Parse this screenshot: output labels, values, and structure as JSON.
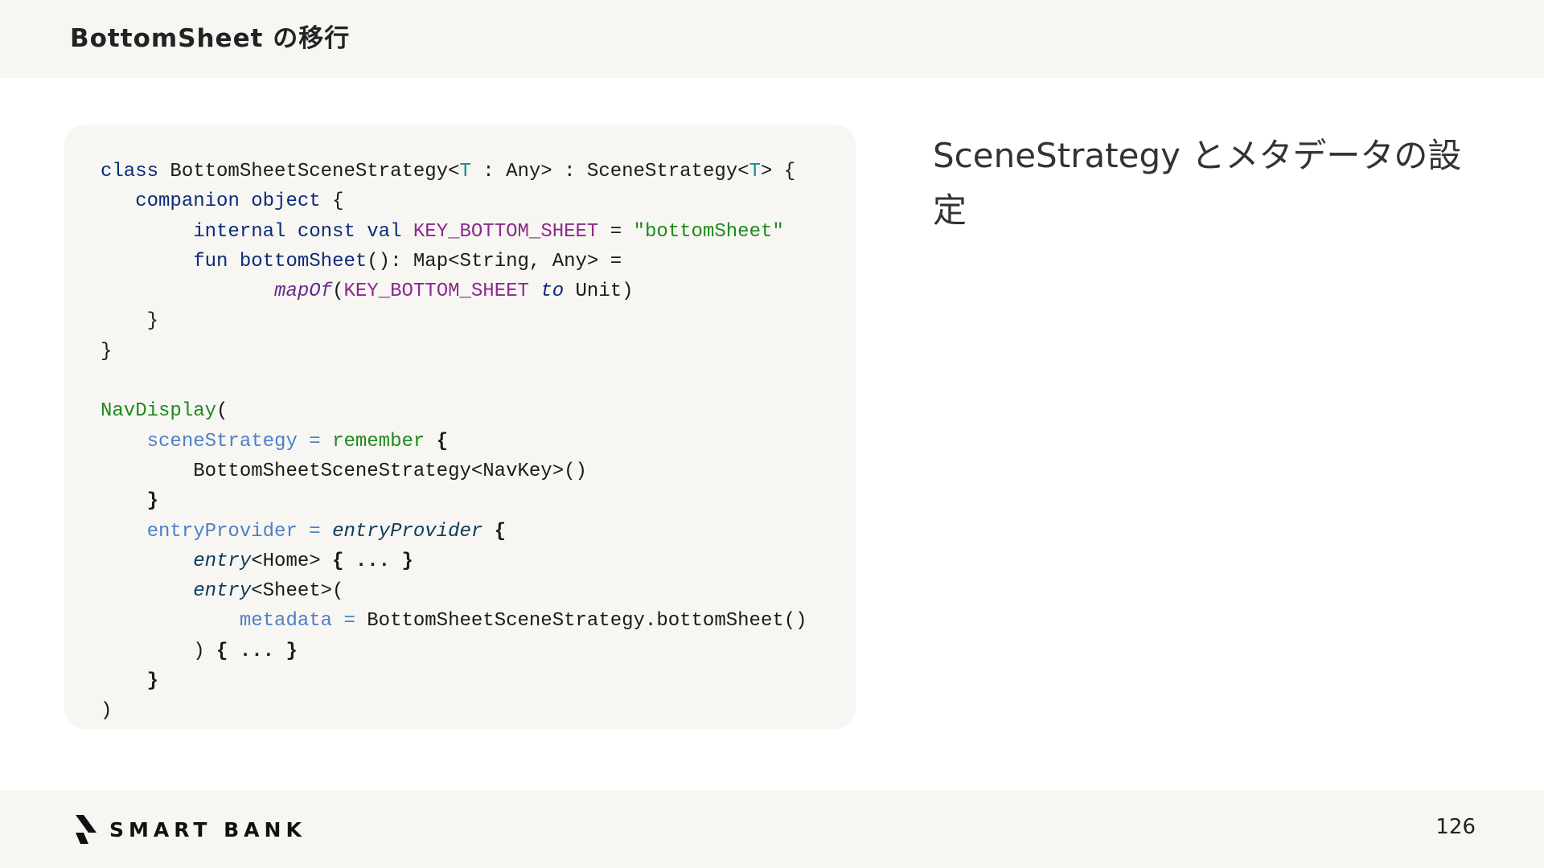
{
  "header": {
    "title": "BottomSheet の移行"
  },
  "code": {
    "lines": [
      "class BottomSheetSceneStrategy<T : Any> : SceneStrategy<T> {",
      "   companion object {",
      "        internal const val KEY_BOTTOM_SHEET = \"bottomSheet\"",
      "        fun bottomSheet(): Map<String, Any> =",
      "               mapOf(KEY_BOTTOM_SHEET to Unit)",
      "    }",
      "}",
      "",
      "NavDisplay(",
      "    sceneStrategy = remember {",
      "        BottomSheetSceneStrategy<NavKey>()",
      "    }",
      "    entryProvider = entryProvider {",
      "        entry<Home> { ... }",
      "        entry<Sheet>(",
      "            metadata = BottomSheetSceneStrategy.bottomSheet()",
      "        ) { ... }",
      "    }",
      ")"
    ]
  },
  "description": {
    "text": "SceneStrategy とメタデータの設定"
  },
  "footer": {
    "brand": "SMART BANK",
    "page_number": "126"
  }
}
